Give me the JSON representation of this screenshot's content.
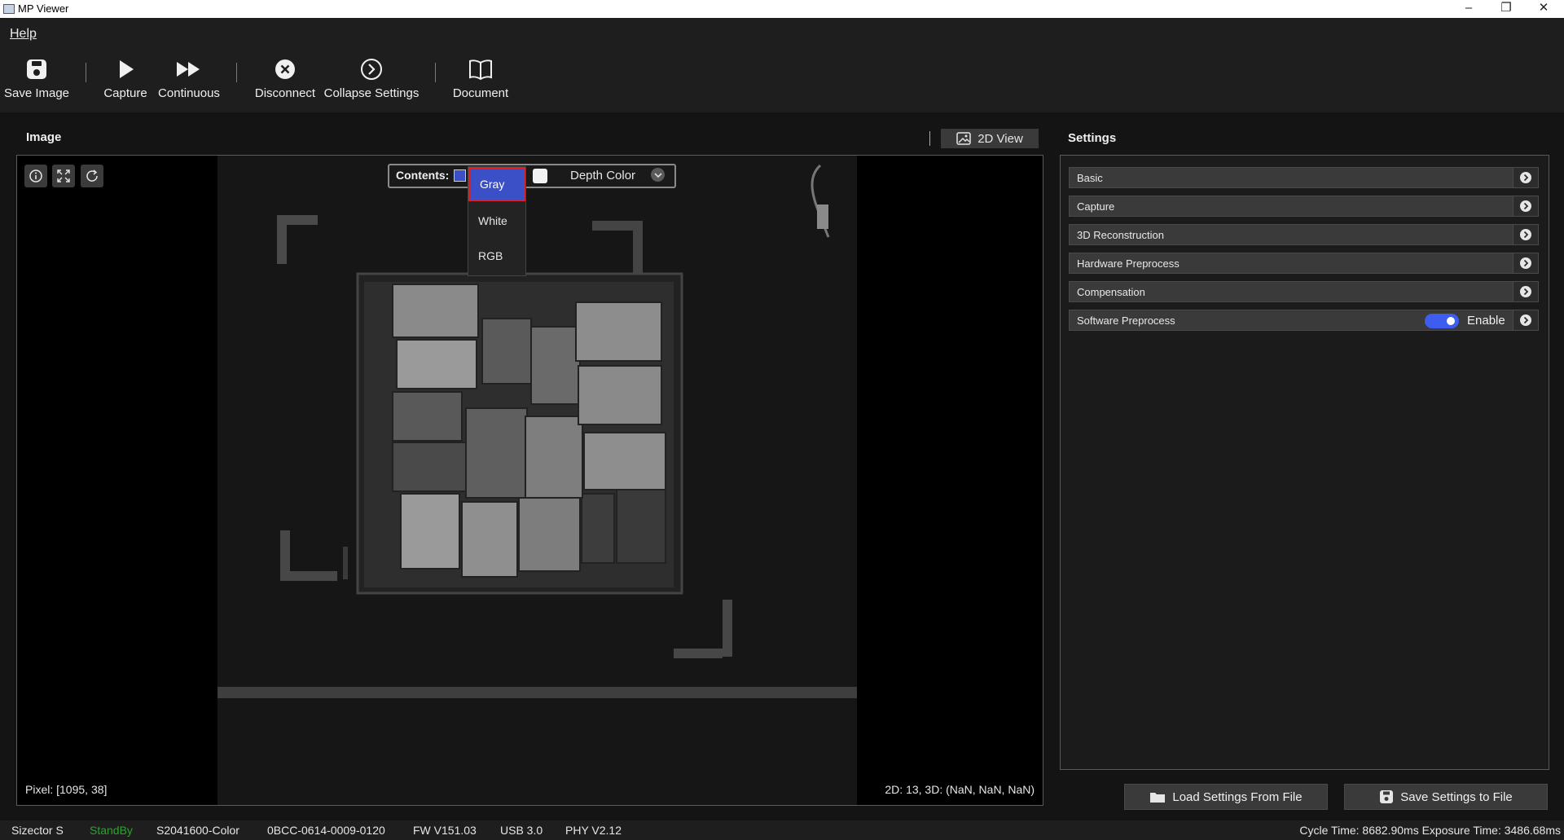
{
  "window": {
    "title": "MP Viewer"
  },
  "menu": {
    "help_label": "Help"
  },
  "toolbar": {
    "save_image": "Save Image",
    "capture": "Capture",
    "continuous": "Continuous",
    "disconnect": "Disconnect",
    "collapse_settings": "Collapse Settings",
    "document": "Document"
  },
  "image_panel": {
    "title": "Image",
    "view_button": "2D View",
    "contents_label": "Contents:",
    "depth_option": "Depth Color",
    "dropdown_options": [
      "Gray",
      "White",
      "RGB"
    ],
    "selected_option": "Gray",
    "pixel_readout": "Pixel: [1095, 38]",
    "value_readout": "2D: 13, 3D: (NaN, NaN, NaN)"
  },
  "settings_panel": {
    "title": "Settings",
    "sections": [
      {
        "label": "Basic"
      },
      {
        "label": "Capture"
      },
      {
        "label": "3D Reconstruction"
      },
      {
        "label": "Hardware Preprocess"
      },
      {
        "label": "Compensation"
      },
      {
        "label": "Software Preprocess"
      }
    ],
    "enable_label": "Enable",
    "software_preprocess_enabled": true,
    "load_button": "Load Settings From File",
    "save_button": "Save Settings to File"
  },
  "status": {
    "device": "Sizector S",
    "state": "StandBy",
    "model": "S2041600-Color",
    "serial": "0BCC-0614-0009-0120",
    "fw": "FW V151.03",
    "usb": "USB 3.0",
    "phy": "PHY V2.12",
    "timing": "Cycle Time: 8682.90ms Exposure Time: 3486.68ms"
  },
  "colors": {
    "accent": "#3b4fc7",
    "toggle": "#3d5cf0",
    "standby": "#2aa52a",
    "highlight_border": "#e02020"
  }
}
